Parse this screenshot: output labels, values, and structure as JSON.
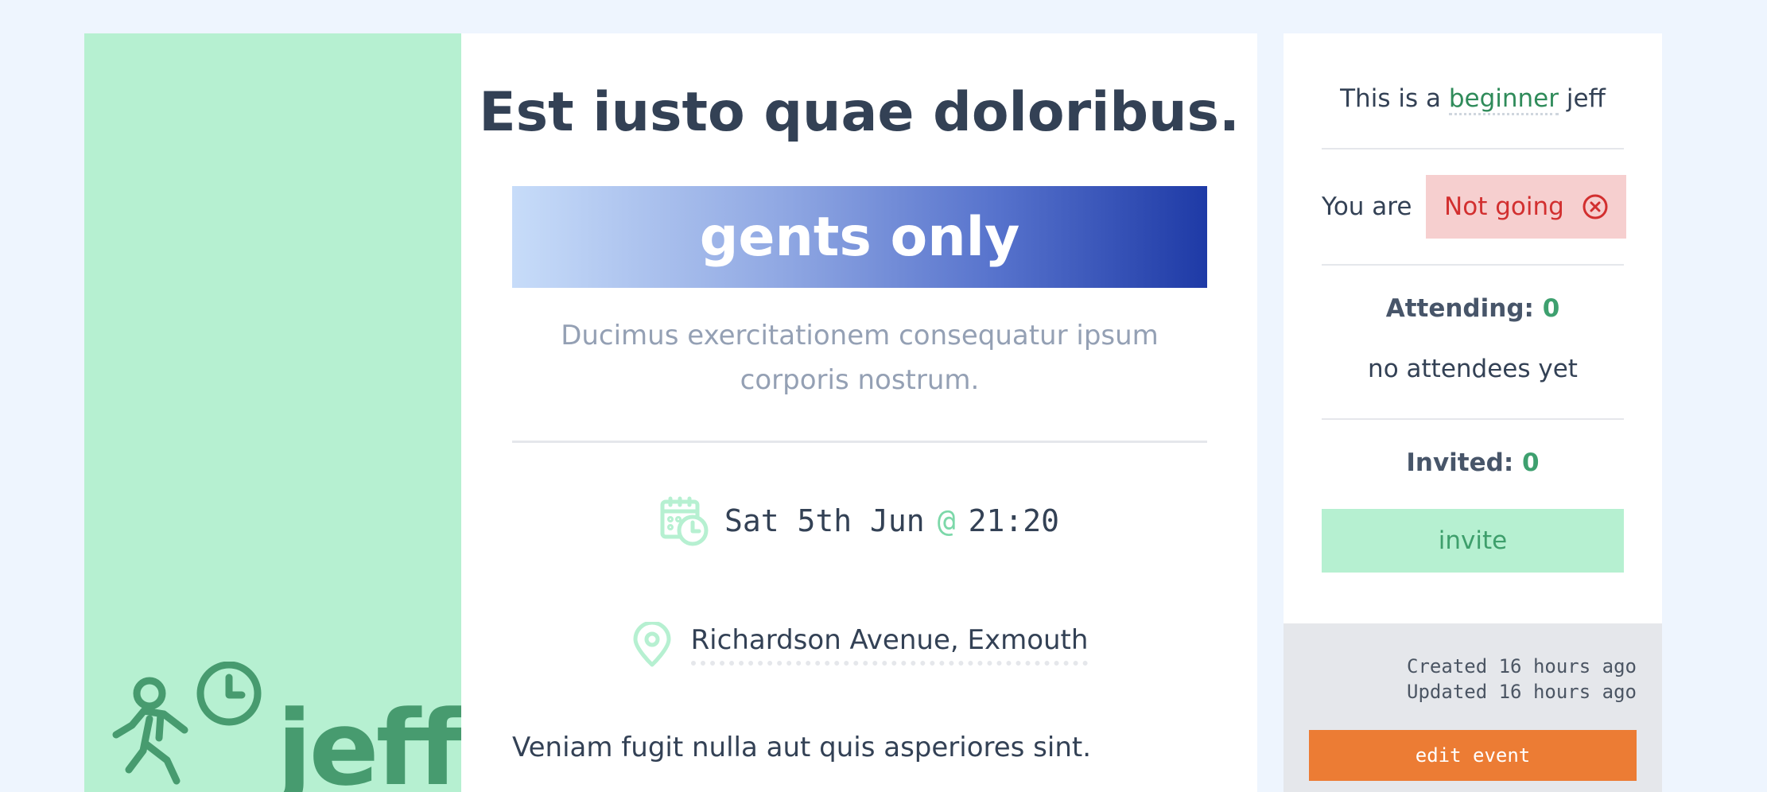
{
  "brand": {
    "name": "jeff",
    "icon": "walking-person-clock-icon",
    "color": "#479b6f",
    "panel_color": "#b6f0d1"
  },
  "event": {
    "title": "Est iusto quae doloribus.",
    "audience": "gents only",
    "subtitle": "Ducimus exercitationem consequatur ipsum corporis nostrum.",
    "date": "Sat 5th Jun",
    "at": "@",
    "time": "21:20",
    "date_icon": "calendar-clock-icon",
    "location": "Richardson Avenue, Exmouth",
    "location_icon": "map-pin-icon",
    "description": "Veniam fugit nulla aut quis asperiores sint."
  },
  "sidebar": {
    "level_prefix": "This is a",
    "level_word": "beginner",
    "level_suffix": "jeff",
    "status_label": "You are",
    "status_value": "Not going",
    "status_icon": "circle-x-icon",
    "attending_label": "Attending:",
    "attending_count": "0",
    "no_attendees": "no attendees yet",
    "invited_label": "Invited:",
    "invited_count": "0",
    "invite_button": "invite",
    "created": "Created 16 hours ago",
    "updated": "Updated 16 hours ago",
    "edit_button": "edit event"
  },
  "colors": {
    "accent_green": "#3ea06f",
    "not_going_bg": "#f6cfcf",
    "not_going_text": "#d22f2f",
    "edit_orange": "#ec7c34",
    "banner_start": "#c7dcf9",
    "banner_end": "#1e3aa6"
  }
}
